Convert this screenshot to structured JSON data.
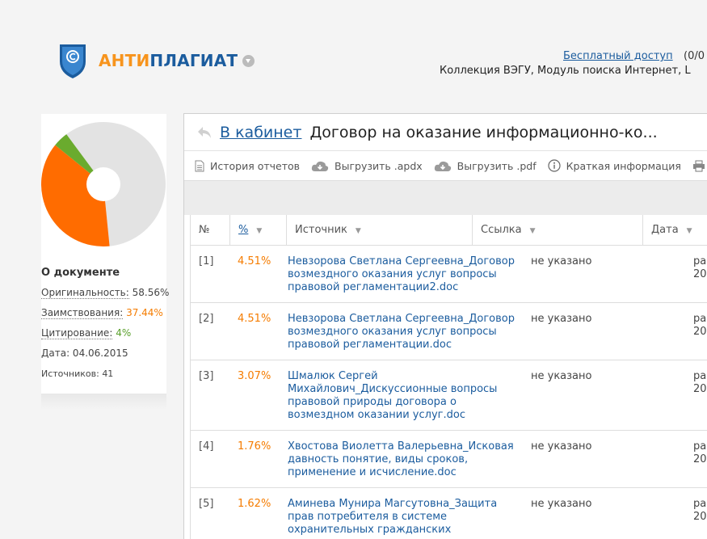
{
  "brand": {
    "part1": "АНТИ",
    "part2": "ПЛАГИАТ"
  },
  "header": {
    "free_access": "Бесплатный доступ",
    "free_count": "(0/0",
    "collection": "Коллекция ВЭГУ, Модуль поиска Интернет, L"
  },
  "left": {
    "about_title": "О документе",
    "originality_label": "Оригинальность:",
    "originality_value": "58.56%",
    "borrowing_label": "Заимствования:",
    "borrowing_value": "37.44%",
    "citation_label": "Цитирование:",
    "citation_value": "4%",
    "date": "Дата: 04.06.2015",
    "sources": "Источников: 41",
    "pie": {
      "original": 58.56,
      "borrowed": 37.44,
      "cited": 4,
      "colors": {
        "original": "#e3e3e3",
        "borrowed": "#ff6c00",
        "cited": "#6aab2e"
      }
    }
  },
  "main": {
    "cabinet_link": "В кабинет",
    "doc_title": "Договор на оказание информационно-ко...",
    "toolbar": {
      "history": "История отчетов",
      "export_apdx": "Выгрузить .apdx",
      "export_pdf": "Выгрузить .pdf",
      "brief": "Краткая информация",
      "print": "В"
    },
    "table": {
      "headers": {
        "num": "№",
        "pct": "%",
        "source": "Источник",
        "link": "Ссылка",
        "date": "Дата"
      },
      "rows": [
        {
          "num": "[1]",
          "pct": "4.51%",
          "source": "Невзорова Светлана Сергеевна_Договор возмездного оказания услуг вопросы правовой регламентации2.doc",
          "link": "не указано",
          "date1": "ра",
          "date2": "20"
        },
        {
          "num": "[2]",
          "pct": "4.51%",
          "source": "Невзорова Светлана Сергеевна_Договор возмездного оказания услуг вопросы правовой регламентации.doc",
          "link": "не указано",
          "date1": "ра",
          "date2": "20"
        },
        {
          "num": "[3]",
          "pct": "3.07%",
          "source": "Шмалюк Сергей Михайлович_Дискуссионные вопросы правовой природы договора о возмездном оказании услуг.doc",
          "link": "не указано",
          "date1": "ра",
          "date2": "20"
        },
        {
          "num": "[4]",
          "pct": "1.76%",
          "source": "Хвостова Виолетта Валерьевна_Исковая давность понятие, виды сроков, применение и исчисление.doc",
          "link": "не указано",
          "date1": "ра",
          "date2": "20"
        },
        {
          "num": "[5]",
          "pct": "1.62%",
          "source": "Аминева Мунира Магсутовна_Защита прав потребителя в системе охранительных гражданских",
          "link": "не указано",
          "date1": "ра",
          "date2": "20"
        }
      ]
    }
  }
}
